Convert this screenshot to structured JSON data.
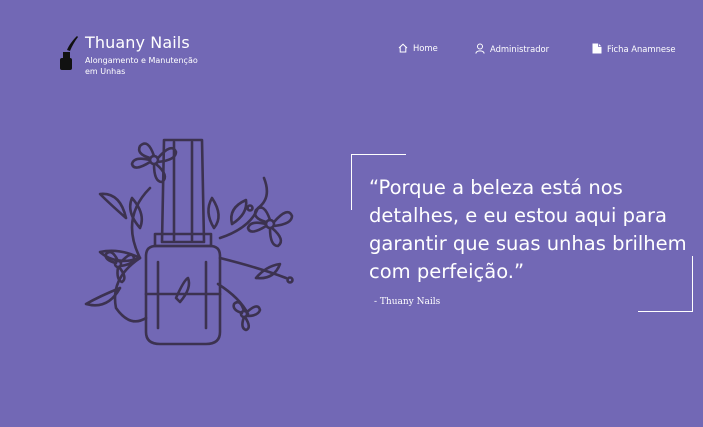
{
  "brand": {
    "icon": "nail-polish-icon",
    "title": "Thuany Nails",
    "subtitle": "Alongamento e Manutenção em Unhas"
  },
  "nav": {
    "items": [
      {
        "label": "Home",
        "icon": "home-icon"
      },
      {
        "label": "Administrador",
        "icon": "user-icon"
      },
      {
        "label": "Ficha Anamnese",
        "icon": "document-icon"
      }
    ]
  },
  "hero": {
    "illustration": "nail-polish-with-flowers-illustration",
    "quote": "“Porque a beleza está nos detalhes, e eu estou aqui para garantir que suas unhas brilhem com perfeição.”",
    "author": "-  Thuany Nails"
  },
  "colors": {
    "background": "#7268b5",
    "text": "#ffffff",
    "illustration_stroke": "#3c3250"
  }
}
